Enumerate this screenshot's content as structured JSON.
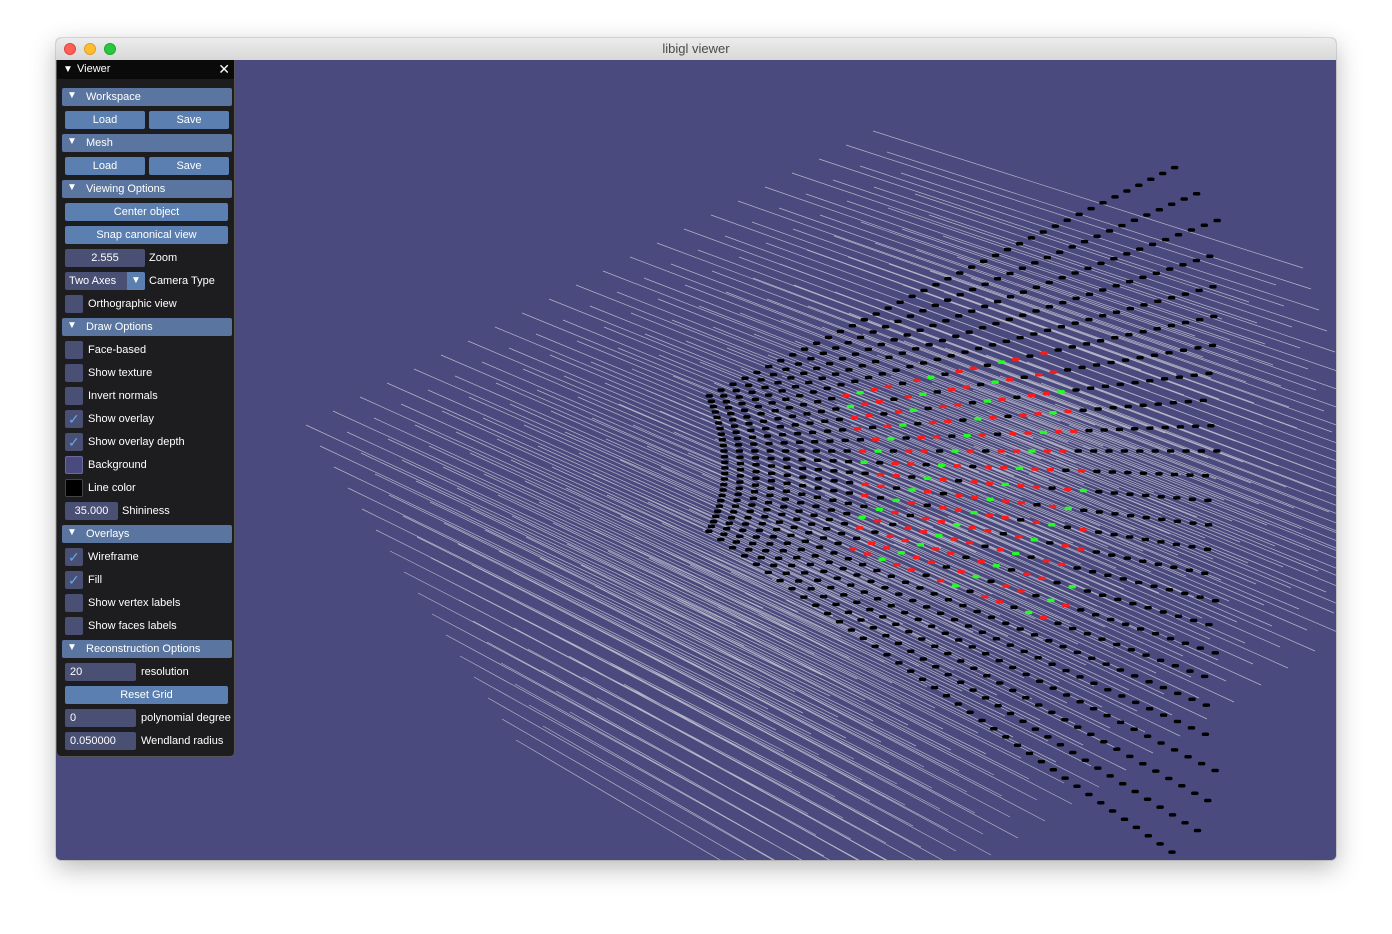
{
  "window": {
    "title": "libigl viewer"
  },
  "colors": {
    "viewport_background": "#4b4a7e",
    "panel_background": "#1d1d1f",
    "header_background": "#5a76a0",
    "button_background": "#5a7fb0",
    "field_background": "#4a4f74",
    "grid_line": "#d8d8e0",
    "point_outside": "#000000",
    "point_inside": "#ff1a1a",
    "point_near": "#20ff20"
  },
  "panel": {
    "title": "Viewer",
    "close_icon": "close-icon",
    "workspace": {
      "header": "Workspace",
      "load": "Load",
      "save": "Save"
    },
    "mesh": {
      "header": "Mesh",
      "load": "Load",
      "save": "Save"
    },
    "viewing": {
      "header": "Viewing Options",
      "center": "Center object",
      "snap": "Snap canonical view",
      "zoom_value": "2.555",
      "zoom_label": "Zoom",
      "camera_value": "Two Axes",
      "camera_label": "Camera Type",
      "ortho_label": "Orthographic view",
      "ortho_checked": false
    },
    "draw": {
      "header": "Draw Options",
      "face_based": "Face-based",
      "show_texture": "Show texture",
      "invert_normals": "Invert normals",
      "show_overlay": "Show overlay",
      "show_overlay_depth": "Show overlay depth",
      "background": "Background",
      "line_color": "Line color",
      "shininess_value": "35.000",
      "shininess_label": "Shininess",
      "background_color": "#4b4a7e",
      "line_color_value": "#000000",
      "checked": {
        "face_based": false,
        "show_texture": false,
        "invert_normals": false,
        "show_overlay": true,
        "show_overlay_depth": true
      }
    },
    "overlays": {
      "header": "Overlays",
      "wireframe": "Wireframe",
      "fill": "Fill",
      "vertex_labels": "Show vertex labels",
      "face_labels": "Show faces labels",
      "checked": {
        "wireframe": true,
        "fill": true,
        "vertex_labels": false,
        "face_labels": false
      }
    },
    "reconstruction": {
      "header": "Reconstruction Options",
      "resolution_value": "20",
      "resolution_label": "resolution",
      "reset_grid": "Reset Grid",
      "degree_value": "0",
      "degree_label": "polynomial degree",
      "radius_value": "0.050000",
      "radius_label": "Wendland radius"
    }
  }
}
